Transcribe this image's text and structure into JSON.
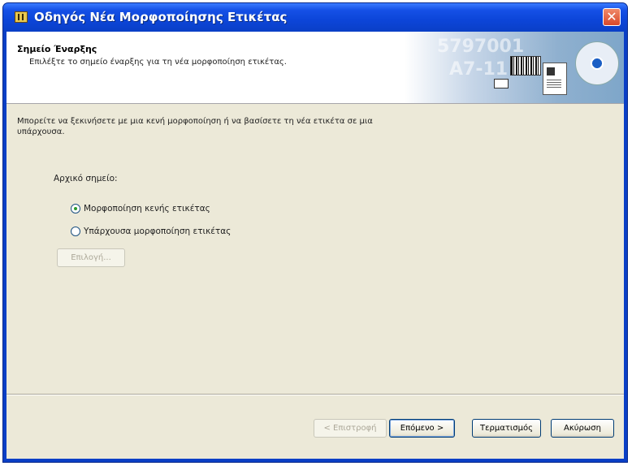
{
  "window": {
    "title": "Οδηγός Νέα Μορφοποίησης Ετικέτας",
    "close_glyph": "✕"
  },
  "header": {
    "title": "Σημείο Έναρξης",
    "subtitle": "Επιλέξτε το σημείο έναρξης για τη νέα μορφοποίηση ετικέτας.",
    "art_text_1": "5797001",
    "art_text_2": "A7-11"
  },
  "body": {
    "intro": "Μπορείτε να ξεκινήσετε με μια κενή μορφοποίηση ή να βασίσετε τη νέα ετικέτα σε μια υπάρχουσα.",
    "start_label": "Αρχικό σημείο:",
    "options": [
      {
        "label": "Μορφοποίηση κενής ετικέτας",
        "checked": true
      },
      {
        "label": "Υπάρχουσα μορφοποίηση ετικέτας",
        "checked": false
      }
    ],
    "browse_label": "Επιλογή..."
  },
  "footer": {
    "back_label": "< Επιστροφή",
    "next_label": "Επόμενο >",
    "finish_label": "Τερματισμός",
    "cancel_label": "Ακύρωση"
  },
  "colors": {
    "titlebar": "#0a3fc6",
    "client": "#ece9d8",
    "close": "#d8482a"
  }
}
